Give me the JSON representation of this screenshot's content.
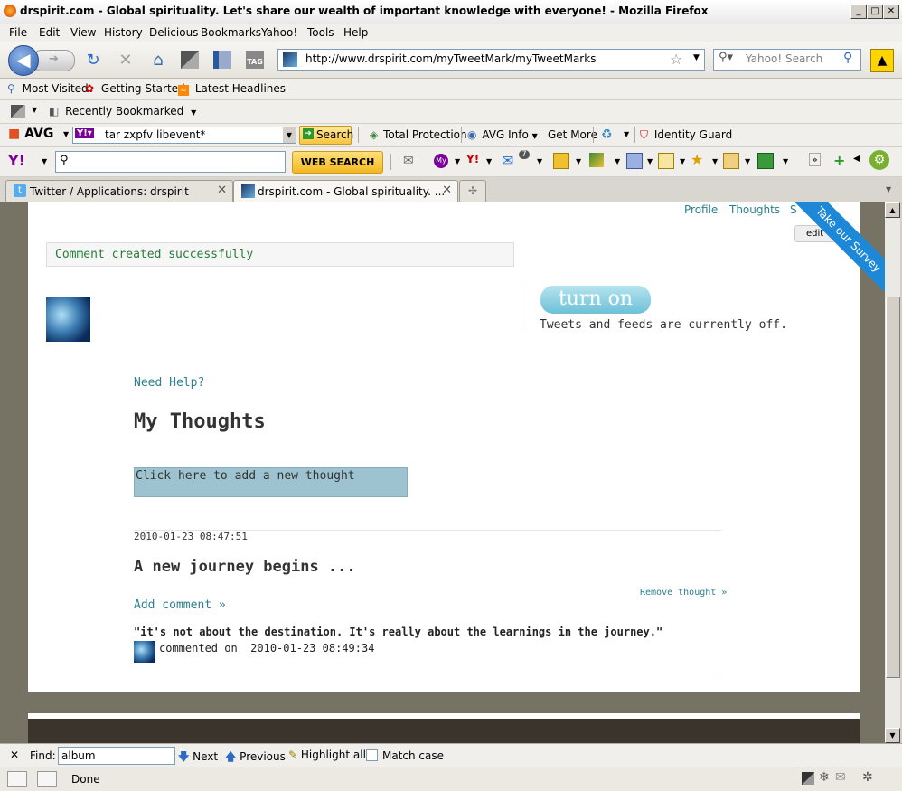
{
  "window": {
    "title": "drspirit.com - Global spirituality. Let's share our wealth of important knowledge with everyone! - Mozilla Firefox"
  },
  "menu": [
    "File",
    "Edit",
    "View",
    "History",
    "Delicious",
    "Bookmarks",
    "Yahoo!",
    "Tools",
    "Help"
  ],
  "nav": {
    "url": "http://www.drspirit.com/myTweetMark/myTweetMarks",
    "search_placeholder": "Yahoo! Search"
  },
  "bookmarks": {
    "most_visited": "Most Visited",
    "getting_started": "Getting Started",
    "latest_headlines": "Latest Headlines",
    "recently_bookmarked": "Recently Bookmarked"
  },
  "avg_toolbar": {
    "brand": "AVG",
    "search_value": "tar zxpfv libevent*",
    "search_button": "Search",
    "total_protection": "Total Protection",
    "avg_info": "AVG Info",
    "get_more": "Get More",
    "identity_guard": "Identity Guard"
  },
  "yahoo_toolbar": {
    "logo": "Y!",
    "web_search": "WEB SEARCH",
    "mail_count": "7"
  },
  "tabs": [
    {
      "label": "Twitter / Applications: drspirit"
    },
    {
      "label": "drspirit.com - Global spirituality. ..."
    }
  ],
  "page": {
    "top_links": {
      "profile": "Profile",
      "thoughts": "Thoughts",
      "s": "S"
    },
    "edit": "edit",
    "ribbon": "Take our Survey",
    "success_message": "Comment created successfully",
    "turn_on": "turn on",
    "feeds_status": "Tweets and feeds are currently off.",
    "need_help": "Need Help?",
    "heading": "My Thoughts",
    "add_thought": "Click here to add a new thought",
    "thought": {
      "timestamp": "2010-01-23 08:47:51",
      "title": "A new journey begins ...",
      "remove": "Remove thought »",
      "add_comment": "Add comment »",
      "comment_text": "\"it's not about the destination. It's really about the learnings in the journey.\"",
      "comment_meta_prefix": "commented on",
      "comment_meta_date": "2010-01-23 08:49:34"
    }
  },
  "findbar": {
    "label": "Find:",
    "value": "album",
    "next": "Next",
    "previous": "Previous",
    "highlight_all": "Highlight all",
    "match_case": "Match case"
  },
  "status": {
    "text": "Done"
  }
}
